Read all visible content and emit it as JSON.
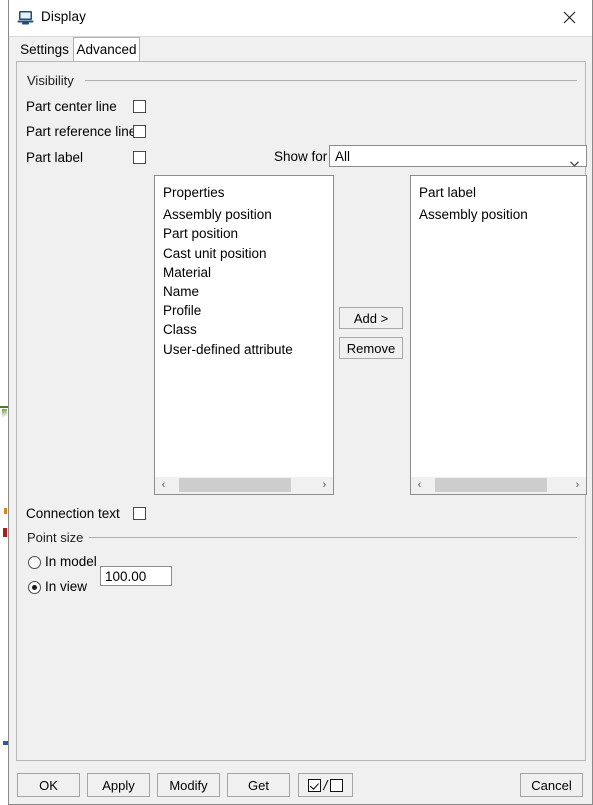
{
  "window": {
    "title": "Display",
    "icon": "display-monitor-icon",
    "close_icon": "close-icon"
  },
  "tabs": [
    {
      "label": "Settings",
      "active": false
    },
    {
      "label": "Advanced",
      "active": true
    }
  ],
  "visibility": {
    "group_label": "Visibility",
    "rows": [
      {
        "label": "Part center line",
        "checked": false
      },
      {
        "label": "Part reference line",
        "checked": false
      },
      {
        "label": "Part label",
        "checked": false
      }
    ],
    "show_for": {
      "label": "Show for",
      "value": "All",
      "arrow_icon": "chevron-down-icon"
    }
  },
  "available_list": {
    "items": [
      "Properties",
      "Assembly position",
      "Part position",
      "Cast unit position",
      "Material",
      "Name",
      "Profile",
      "Class",
      "User-defined attribute"
    ],
    "scroll": {
      "left_arrow": "‹",
      "right_arrow": "›",
      "thumb_start_pct": 4,
      "thumb_width_pct": 72
    }
  },
  "selected_list": {
    "items": [
      "Part label",
      "Assembly position"
    ],
    "scroll": {
      "left_arrow": "‹",
      "right_arrow": "›",
      "thumb_start_pct": 4,
      "thumb_width_pct": 72
    }
  },
  "transfer_buttons": {
    "add": "Add >",
    "remove": "Remove"
  },
  "connection_text": {
    "label": "Connection text",
    "checked": false
  },
  "point_size": {
    "group_label": "Point size",
    "options": [
      {
        "label": "In model",
        "selected": false
      },
      {
        "label": "In view",
        "selected": true
      }
    ],
    "value": "100.00"
  },
  "footer": {
    "ok": "OK",
    "apply": "Apply",
    "modify": "Modify",
    "get": "Get",
    "toggle_all_tooltip": "",
    "cancel": "Cancel"
  },
  "colors": {
    "dialog_bg": "#f0f0f0",
    "titlebar_bg": "#ffffff",
    "field_bg": "#ffffff",
    "border": "#8d8d8d",
    "icon_blue": "#1f4e79",
    "scroll_thumb": "#cdcdcd"
  }
}
